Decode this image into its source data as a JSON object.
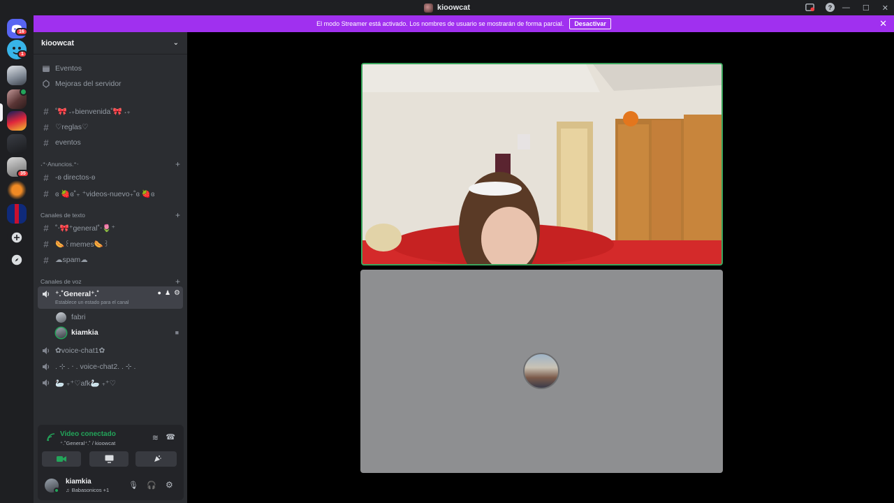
{
  "window": {
    "title": "kioowcat"
  },
  "rail": {
    "badges": [
      "16",
      "1",
      "35"
    ]
  },
  "banner": {
    "message": "El modo Streamer está activado. Los nombres de usuario se mostrarán de forma parcial.",
    "button": "Desactivar"
  },
  "sidebar": {
    "server_name": "kioowcat",
    "top_items": [
      {
        "label": "Eventos",
        "icon": "calendar-icon"
      },
      {
        "label": "Mejoras del servidor",
        "icon": "boost-icon"
      }
    ],
    "channels_general": [
      {
        "label": "˚🎀 ˖₊bienvenida˚🎀 ˖₊"
      },
      {
        "label": "♡reglas♡"
      },
      {
        "label": "eventos"
      }
    ],
    "cat_anuncios": "˖⁺‧Anuncios.⁺‧",
    "channels_anuncios": [
      {
        "label": "-ʚ directos-ʚ"
      },
      {
        "label": "ɞ 🍓ɞ˚₊ ⁺videos-nuevo₊˚ɞ 🍓ɞ"
      }
    ],
    "cat_texto": "Canales de texto",
    "channels_texto": [
      {
        "label": "˚‧🎀⁺general˚‧🌷⁺"
      },
      {
        "label": "🌭꒰memes🌭꒱"
      },
      {
        "label": "☁spam☁"
      }
    ],
    "cat_voz": "Canales de voz",
    "voice_active": {
      "label": "⁺.˚General⁺.˚",
      "status_hint": "Establece un estado para el canal"
    },
    "voice_users": [
      {
        "name": "fabri"
      },
      {
        "name": "kiamkia"
      }
    ],
    "voice_channels": [
      {
        "label": "✿voice-chat1✿"
      },
      {
        "label": ". ⊹ . ⋅ . voice-chat2. . ⊹ ."
      },
      {
        "label": "🦢 ₊⁺♡afk🦢 ₊⁺♡"
      }
    ]
  },
  "panel": {
    "status": "Video conectado",
    "sub": "⁺.˚General⁺.˚ / kioowcat",
    "user": "kiamkia",
    "activity": "Babasonicos +1"
  }
}
